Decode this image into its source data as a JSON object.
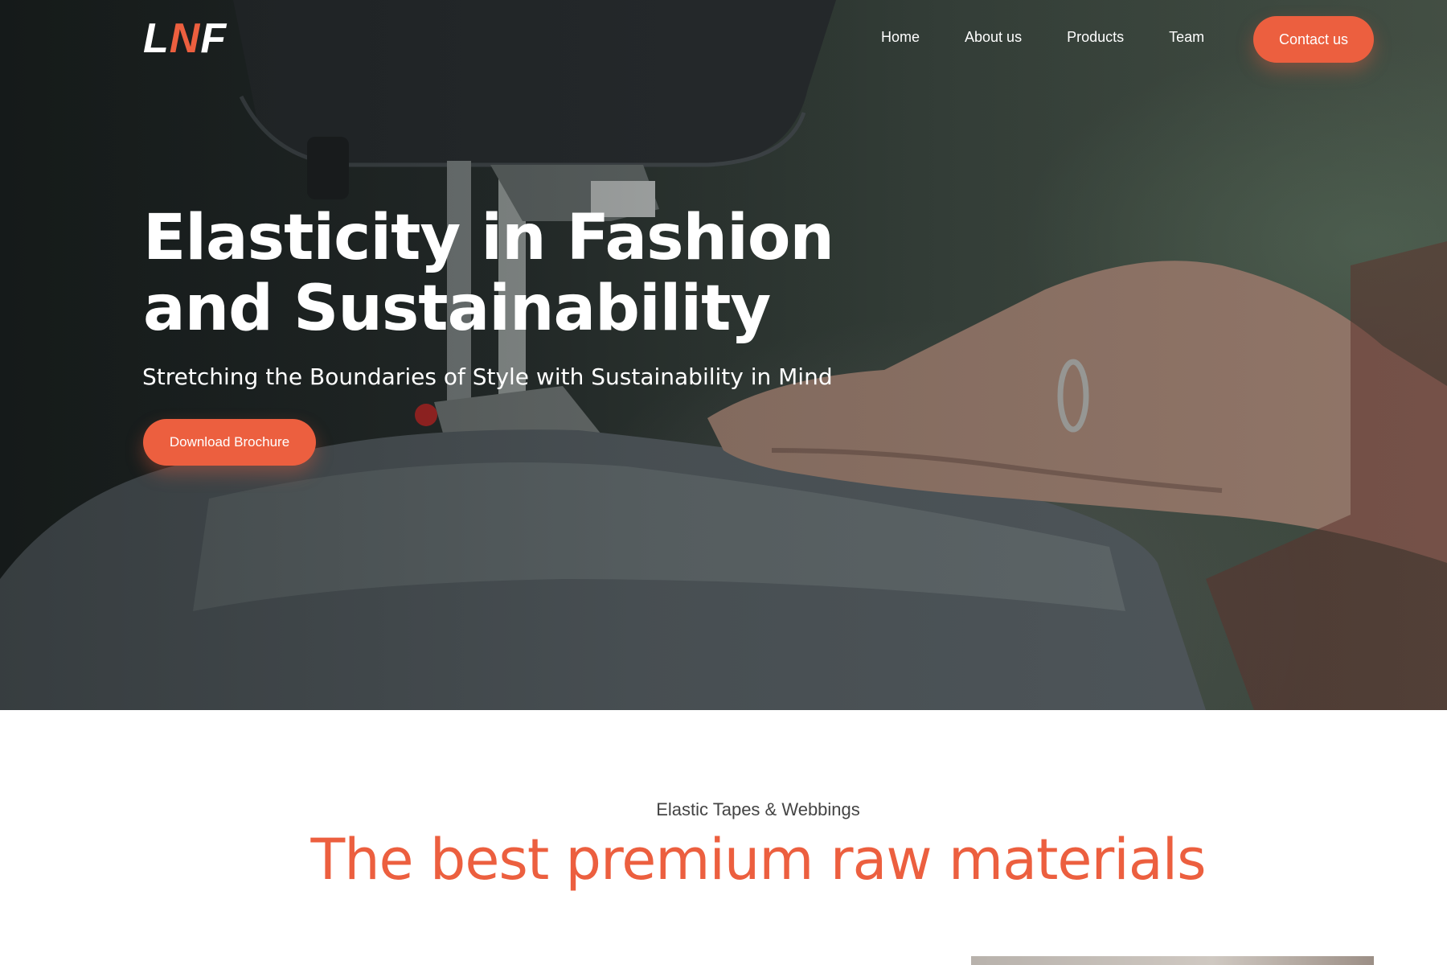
{
  "nav": {
    "logo": {
      "part1": "L",
      "part2": "N",
      "part3": "F"
    },
    "links": [
      "Home",
      "About us",
      "Products",
      "Team"
    ],
    "contact_label": "Contact us"
  },
  "hero": {
    "title": "Elasticity in Fashion and Sustainability",
    "subtitle": "Stretching the Boundaries of Style with Sustainability in Mind",
    "cta_label": "Download Brochure",
    "image_description_icon": "sewing-machine-photo"
  },
  "section": {
    "eyebrow": "Elastic Tapes & Webbings",
    "heading": "The best premium raw materials"
  },
  "colors": {
    "accent": "#ec5f3f",
    "text_light": "#ffffff",
    "text_muted": "#444444"
  }
}
